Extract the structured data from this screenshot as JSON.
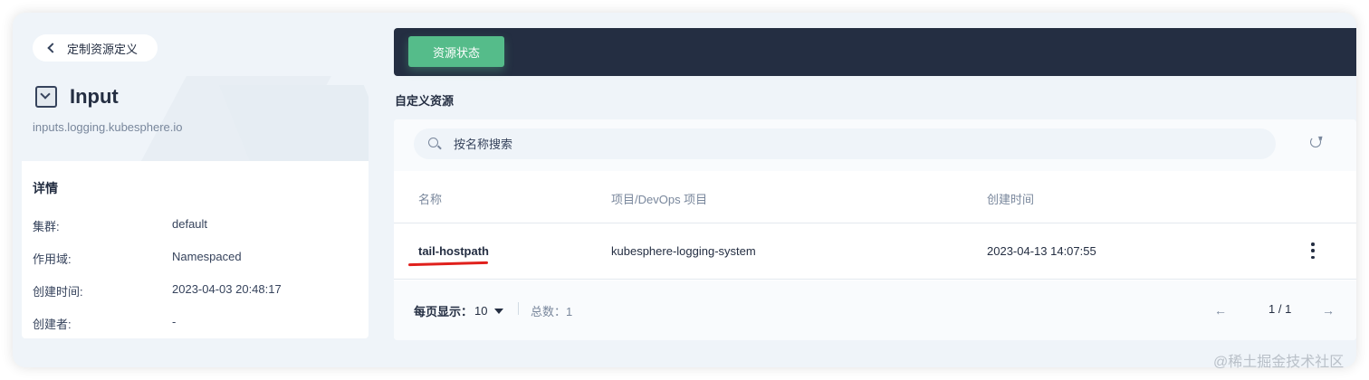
{
  "left": {
    "back_label": "定制资源定义",
    "title": "Input",
    "subtitle": "inputs.logging.kubesphere.io",
    "details_title": "详情",
    "details": [
      {
        "key": "集群:",
        "value": "default"
      },
      {
        "key": "作用域:",
        "value": "Namespaced"
      },
      {
        "key": "创建时间:",
        "value": "2023-04-03 20:48:17"
      },
      {
        "key": "创建者:",
        "value": "-"
      }
    ]
  },
  "topbar": {
    "tab_label": "资源状态"
  },
  "section_title": "自定义资源",
  "search": {
    "placeholder": "按名称搜索"
  },
  "table": {
    "columns": [
      "名称",
      "项目/DevOps 项目",
      "创建时间"
    ],
    "rows": [
      {
        "name": "tail-hostpath",
        "project": "kubesphere-logging-system",
        "created": "2023-04-13 14:07:55"
      }
    ]
  },
  "footer": {
    "page_size_label": "每页显示：",
    "page_size": "10",
    "total": "总数：1",
    "pager": "1 / 1",
    "prev": "←",
    "next": "→"
  },
  "watermark": "@稀土掘金技术社区",
  "colors": {
    "accent": "#55bc8a",
    "topbar": "#242e42",
    "annotation": "#e0201c"
  }
}
